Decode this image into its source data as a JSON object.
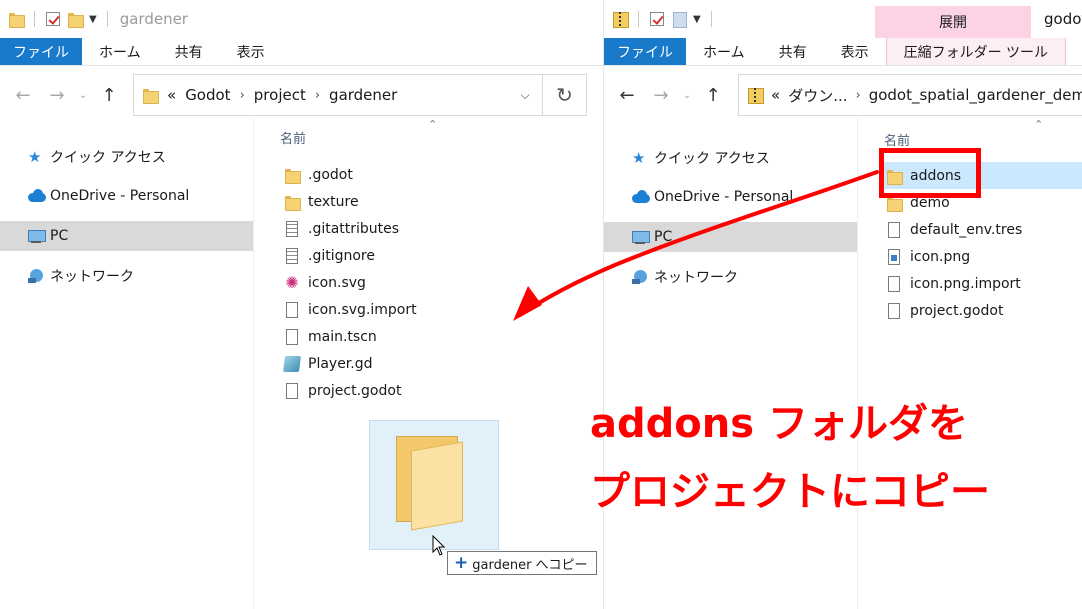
{
  "left_window": {
    "title": "gardener",
    "ribbon_tabs": [
      "ファイル",
      "ホーム",
      "共有",
      "表示"
    ],
    "address": {
      "prefix": "«",
      "crumbs": [
        "Godot",
        "project",
        "gardener"
      ]
    },
    "nav": [
      "クイック アクセス",
      "OneDrive - Personal",
      "PC",
      "ネットワーク"
    ],
    "column_header": "名前",
    "files": [
      {
        "name": ".godot",
        "icon": "folder-icon"
      },
      {
        "name": "texture",
        "icon": "folder-icon"
      },
      {
        "name": ".gitattributes",
        "icon": "text-file-icon"
      },
      {
        "name": ".gitignore",
        "icon": "text-file-icon"
      },
      {
        "name": "icon.svg",
        "icon": "svg-file-icon"
      },
      {
        "name": "icon.svg.import",
        "icon": "file-icon"
      },
      {
        "name": "main.tscn",
        "icon": "file-icon"
      },
      {
        "name": "Player.gd",
        "icon": "script-file-icon"
      },
      {
        "name": "project.godot",
        "icon": "file-icon"
      }
    ]
  },
  "right_window": {
    "title": "godot",
    "context_tab_header": "展開",
    "ribbon_tabs": [
      "ファイル",
      "ホーム",
      "共有",
      "表示",
      "圧縮フォルダー ツール"
    ],
    "address": {
      "prefix": "«",
      "crumbs": [
        "ダウン...",
        "godot_spatial_gardener_dem..."
      ]
    },
    "nav": [
      "クイック アクセス",
      "OneDrive - Personal",
      "PC",
      "ネットワーク"
    ],
    "column_header": "名前",
    "files": [
      {
        "name": "addons",
        "icon": "folder-icon"
      },
      {
        "name": "demo",
        "icon": "folder-icon"
      },
      {
        "name": "default_env.tres",
        "icon": "file-icon"
      },
      {
        "name": "icon.png",
        "icon": "png-file-icon"
      },
      {
        "name": "icon.png.import",
        "icon": "file-icon"
      },
      {
        "name": "project.godot",
        "icon": "file-icon"
      }
    ]
  },
  "drag": {
    "tooltip": "gardener へコピー"
  },
  "annotation": {
    "line1": "addons フォルダを",
    "line2": "プロジェクトにコピー",
    "color": "#ff0000"
  },
  "colors": {
    "file_tab": "#1979ca",
    "context_tab": "#fbd3e4",
    "selection": "#cce8ff",
    "nav_selected": "#d9d9d9"
  }
}
